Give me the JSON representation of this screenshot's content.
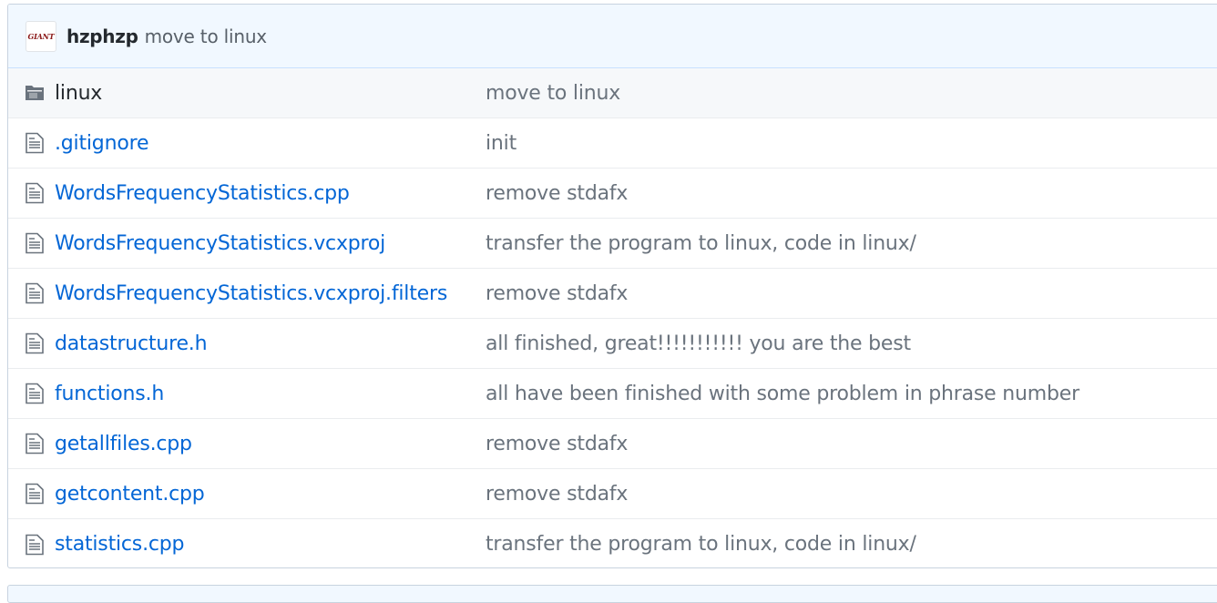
{
  "commit": {
    "avatar_text": "GIANT",
    "author": "hzphzp",
    "message": "move to linux"
  },
  "colors": {
    "link": "#0366d6",
    "commit_bar_bg": "#f1f8ff",
    "muted_text": "#6a737d",
    "icon": "#6a737d"
  },
  "files": [
    {
      "type": "directory",
      "icon": "folder-icon",
      "name": "linux",
      "commit": "move to linux"
    },
    {
      "type": "file",
      "icon": "file-icon",
      "name": ".gitignore",
      "commit": "init"
    },
    {
      "type": "file",
      "icon": "file-icon",
      "name": "WordsFrequencyStatistics.cpp",
      "commit": "remove stdafx"
    },
    {
      "type": "file",
      "icon": "file-icon",
      "name": "WordsFrequencyStatistics.vcxproj",
      "commit": "transfer the program to linux, code in linux/"
    },
    {
      "type": "file",
      "icon": "file-icon",
      "name": "WordsFrequencyStatistics.vcxproj.filters",
      "commit": "remove stdafx"
    },
    {
      "type": "file",
      "icon": "file-icon",
      "name": "datastructure.h",
      "commit": "all finished, great!!!!!!!!!!! you are the best"
    },
    {
      "type": "file",
      "icon": "file-icon",
      "name": "functions.h",
      "commit": "all have been finished with some problem in phrase number"
    },
    {
      "type": "file",
      "icon": "file-icon",
      "name": "getallfiles.cpp",
      "commit": "remove stdafx"
    },
    {
      "type": "file",
      "icon": "file-icon",
      "name": "getcontent.cpp",
      "commit": "remove stdafx"
    },
    {
      "type": "file",
      "icon": "file-icon",
      "name": "statistics.cpp",
      "commit": "transfer the program to linux, code in linux/"
    }
  ]
}
